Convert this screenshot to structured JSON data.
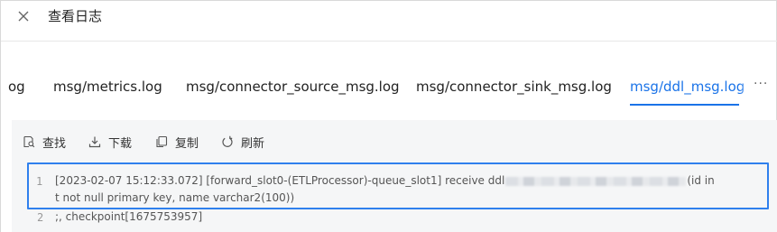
{
  "header": {
    "title": "查看日志"
  },
  "tabs": [
    {
      "label": "og"
    },
    {
      "label": "msg/metrics.log"
    },
    {
      "label": "msg/connector_source_msg.log"
    },
    {
      "label": "msg/connector_sink_msg.log"
    },
    {
      "label": "msg/ddl_msg.log",
      "active": true
    }
  ],
  "tab_more": "···",
  "toolbar": {
    "find_label": "查找",
    "download_label": "下载",
    "copy_label": "复制",
    "refresh_label": "刷新"
  },
  "log_lines": [
    {
      "number": "1",
      "part1": "[2023-02-07 15:12:33.072] [forward_slot0-(ETLProcessor)-queue_slot1] receive ddl",
      "part2": "(id in",
      "wrap": "t not null primary key, name varchar2(100))"
    },
    {
      "number": "2",
      "text": ";, checkpoint[1675753957]"
    }
  ],
  "colors": {
    "accent": "#1a73e8",
    "highlight_border": "#2f80ed",
    "panel_bg": "#f5f6f7"
  }
}
